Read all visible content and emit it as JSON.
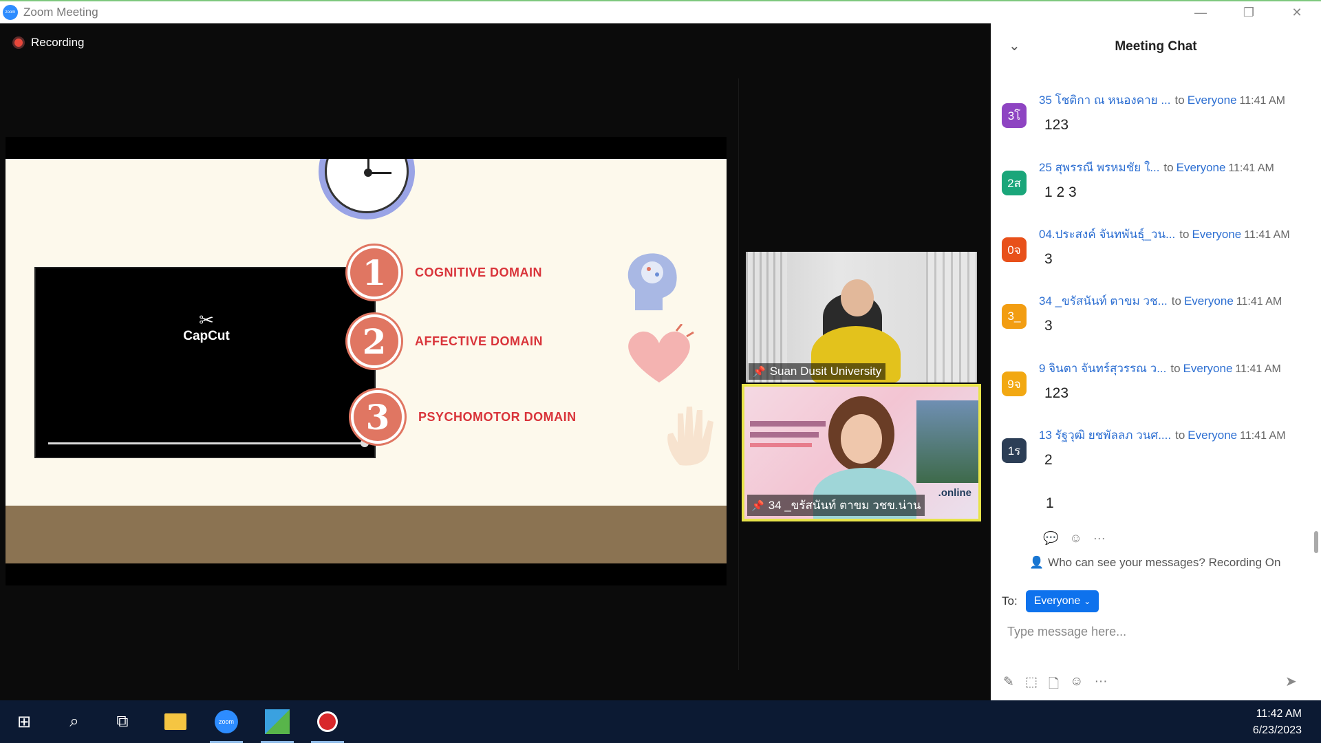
{
  "window": {
    "title": "Zoom Meeting",
    "logo_text": "zoom",
    "minimize": "—",
    "restore": "❐",
    "close": "✕"
  },
  "meeting": {
    "recording_label": "Recording"
  },
  "slide": {
    "capcut_logo_icon": "✂",
    "capcut_label": "CapCut",
    "tiktok_icon": "♪",
    "domains": [
      {
        "num": "1",
        "label": "COGNITIVE DOMAIN"
      },
      {
        "num": "2",
        "label": "AFFECTIVE DOMAIN"
      },
      {
        "num": "3",
        "label": "PSYCHOMOTOR DOMAIN"
      }
    ],
    "video_progress": 0.97
  },
  "tiles": [
    {
      "name": "Suan Dusit University"
    },
    {
      "name": "34 _ขรัสนันท์ ตาขม วชข.น่าน",
      "banner_tag": ".online"
    }
  ],
  "chat": {
    "title": "Meeting Chat",
    "collapse_icon": "⌄",
    "messages": [
      {
        "avatar": "3โ",
        "avatar_color": "#8e44c2",
        "sender": "35 โชติกา ณ หนองคาย ...",
        "to": "to",
        "recipient": "Everyone",
        "time": "11:41 AM",
        "text": "123"
      },
      {
        "avatar": "2ส",
        "avatar_color": "#1aa67a",
        "sender": "25 สุพรรณี  พรหมชัย ใ...",
        "to": "to",
        "recipient": "Everyone",
        "time": "11:41 AM",
        "text": "1 2 3"
      },
      {
        "avatar": "0จ",
        "avatar_color": "#e8501a",
        "sender": "04.ประสงค์ จันทพันธุ์_วน...",
        "to": "to",
        "recipient": "Everyone",
        "time": "11:41 AM",
        "text": "3"
      },
      {
        "avatar": "3_",
        "avatar_color": "#f29d12",
        "sender": "34 _ขรัสนันท์ ตาขม วช...",
        "to": "to",
        "recipient": "Everyone",
        "time": "11:41 AM",
        "text": "3"
      },
      {
        "avatar": "9จ",
        "avatar_color": "#f2a812",
        "sender": "9 จินตา จันทร์สุวรรณ ว...",
        "to": "to",
        "recipient": "Everyone",
        "time": "11:41 AM",
        "text": "123"
      },
      {
        "avatar": "1ร",
        "avatar_color": "#2c3e56",
        "sender": "13 รัฐวุฒิ ยชพัลลภ วนศ....",
        "to": "to",
        "recipient": "Everyone",
        "time": "11:41 AM",
        "text": "2"
      }
    ],
    "extra_message": "1",
    "actions": {
      "reply_icon": "💬",
      "react_icon": "☺",
      "more_icon": "···"
    },
    "visibility_icon": "👤",
    "visibility_text": "Who can see your messages? Recording On",
    "to_label": "To:",
    "to_value": "Everyone",
    "to_chevron": "⌄",
    "input_placeholder": "Type message here...",
    "tools": {
      "format_icon": "✎",
      "screenshot_icon": "⬚",
      "file_icon": "🗋",
      "emoji_icon": "☺",
      "more_icon": "···"
    },
    "send_icon": "➤"
  },
  "taskbar": {
    "start_icon": "⊞",
    "search_icon": "⌕",
    "taskview_icon": "⧉",
    "zoom_badge": "zoom",
    "time": "11:42 AM",
    "date": "6/23/2023"
  }
}
